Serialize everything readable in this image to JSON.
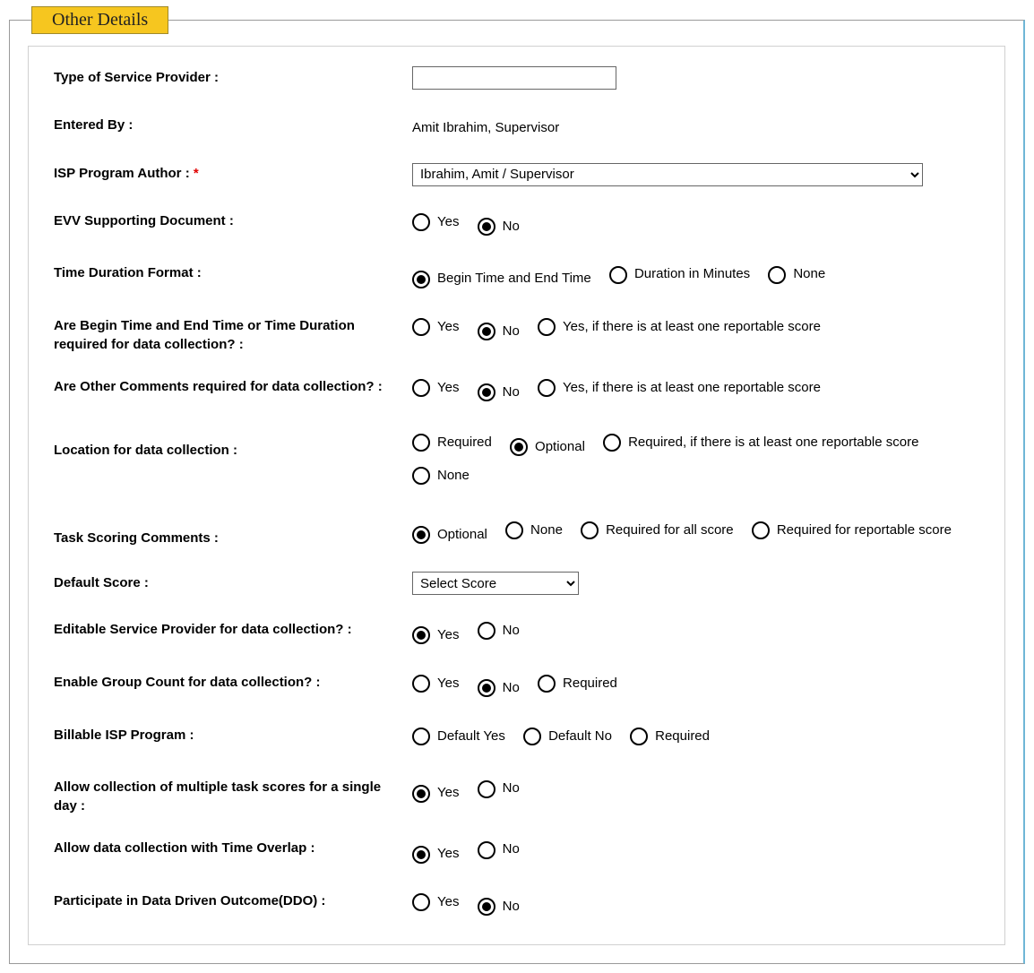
{
  "legend": "Other Details",
  "fields": {
    "type_of_service_provider": {
      "label": "Type of Service Provider :",
      "value": ""
    },
    "entered_by": {
      "label": "Entered By :",
      "value": "Amit Ibrahim, Supervisor"
    },
    "isp_program_author": {
      "label": "ISP Program Author :",
      "required_mark": "*",
      "selected": "Ibrahim, Amit / Supervisor"
    },
    "evv_supporting_document": {
      "label": "EVV Supporting Document :",
      "options": {
        "yes": "Yes",
        "no": "No"
      },
      "selected": "no"
    },
    "time_duration_format": {
      "label": "Time Duration Format :",
      "options": {
        "begin_end": "Begin Time and End Time",
        "minutes": "Duration in Minutes",
        "none": "None"
      },
      "selected": "begin_end"
    },
    "time_required": {
      "label": "Are Begin Time and End Time or Time Duration required for data collection? :",
      "options": {
        "yes": "Yes",
        "no": "No",
        "conditional": "Yes, if there is at least one reportable score"
      },
      "selected": "no"
    },
    "other_comments_required": {
      "label": "Are Other Comments required for data collection? :",
      "options": {
        "yes": "Yes",
        "no": "No",
        "conditional": "Yes, if there is at least one reportable score"
      },
      "selected": "no"
    },
    "location_for_data_collection": {
      "label": "Location for data collection :",
      "options": {
        "required": "Required",
        "optional": "Optional",
        "conditional": "Required, if there is at least one reportable score",
        "none": "None"
      },
      "selected": "optional"
    },
    "task_scoring_comments": {
      "label": "Task Scoring Comments :",
      "options": {
        "optional": "Optional",
        "none": "None",
        "required_all": "Required for all score",
        "required_reportable": "Required for reportable score"
      },
      "selected": "optional"
    },
    "default_score": {
      "label": "Default Score :",
      "selected": "Select Score"
    },
    "editable_service_provider": {
      "label": "Editable Service Provider for data collection? :",
      "options": {
        "yes": "Yes",
        "no": "No"
      },
      "selected": "yes"
    },
    "enable_group_count": {
      "label": "Enable Group Count for data collection? :",
      "options": {
        "yes": "Yes",
        "no": "No",
        "required": "Required"
      },
      "selected": "no"
    },
    "billable_isp_program": {
      "label": "Billable ISP Program :",
      "options": {
        "default_yes": "Default Yes",
        "default_no": "Default No",
        "required": "Required"
      },
      "selected": ""
    },
    "allow_multiple_task_scores": {
      "label": "Allow collection of multiple task scores for a single day :",
      "options": {
        "yes": "Yes",
        "no": "No"
      },
      "selected": "yes"
    },
    "allow_time_overlap": {
      "label": "Allow data collection with Time Overlap :",
      "options": {
        "yes": "Yes",
        "no": "No"
      },
      "selected": "yes"
    },
    "participate_ddo": {
      "label": "Participate in Data Driven Outcome(DDO) :",
      "options": {
        "yes": "Yes",
        "no": "No"
      },
      "selected": "no"
    }
  }
}
